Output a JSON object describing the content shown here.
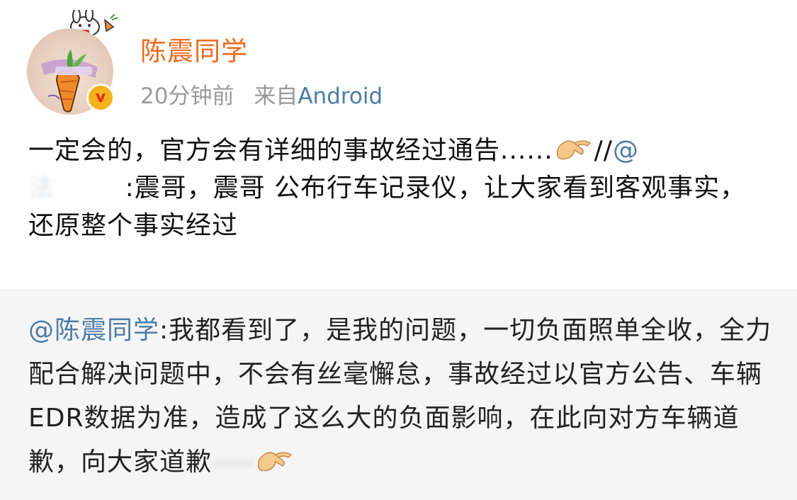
{
  "post": {
    "username": "陈震同学",
    "time": "20分钟前",
    "source_prefix": "来自",
    "source_app": "Android",
    "verified_badge": "v",
    "text_line1": "一定会的，官方会有详细的事故经过通告......",
    "text_sep": "//",
    "mention_at": "@",
    "mention_name_blurred": "法",
    "quoted_text": ":震哥，震哥 公布行车记录仪，让大家看到客观事实，还原整个事实经过",
    "emoji": "pinching-hand"
  },
  "repost": {
    "mention": "@陈震同学",
    "text": ":我都看到了，是我的问题，一切负面照单全收，全力配合解决问题中，不会有丝毫懈怠，事故经过以官方公告、车辆EDR数据为准，造成了这么大的负面影响，在此向对方车辆道歉，向大家道歉",
    "emoji": "pinching-hand"
  },
  "colors": {
    "username": "#f06a20",
    "link": "#4d7ba8",
    "meta": "#9a9a9a",
    "repost_bg": "#f5f5f5",
    "badge": "#f6b21a"
  }
}
